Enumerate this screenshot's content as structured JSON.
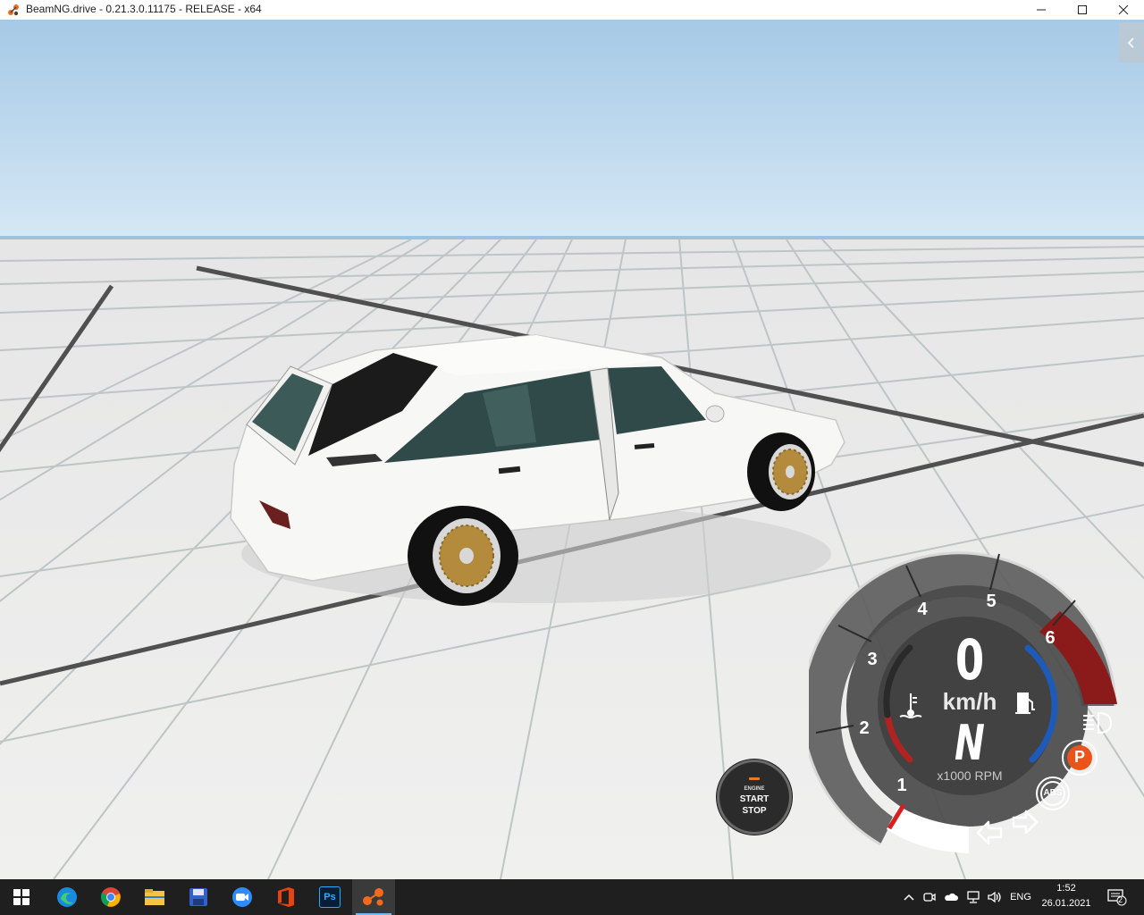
{
  "window": {
    "title": "BeamNG.drive - 0.21.3.0.11175 - RELEASE - x64",
    "controls": [
      "minimize-icon",
      "maximize-icon",
      "close-icon"
    ]
  },
  "scene": {
    "description_icons": [
      "chevron-left-icon"
    ],
    "sky_color": "#c6dff2",
    "ground_color": "#dededd"
  },
  "engine_button": {
    "small_label": "ENGINE",
    "start_label": "START",
    "stop_label": "STOP",
    "led_color": "#f07a18"
  },
  "dashboard": {
    "speed": "0",
    "speed_unit": "km/h",
    "gear": "N",
    "rpm_label": "x1000 RPM",
    "rpm_ticks": [
      "1",
      "2",
      "3",
      "4",
      "5",
      "6"
    ],
    "indicators": [
      "coolant-temp-icon",
      "fuel-icon",
      "headlight-icon",
      "parking-brake-icon",
      "abs-icon",
      "turn-left-icon",
      "turn-right-icon"
    ],
    "parking_label": "P",
    "abs_label": "ABS",
    "redline_color": "#8b1a1a",
    "fuel_bar_color": "#1e5bb8",
    "temp_bar_color": "#b22222"
  },
  "taskbar": {
    "apps": [
      "windows-start-icon",
      "edge-icon",
      "chrome-icon",
      "file-explorer-icon",
      "save-app-icon",
      "zoom-icon",
      "office-icon",
      "photoshop-icon",
      "beamng-icon"
    ],
    "photoshop_label": "Ps",
    "language": "ENG",
    "time": "1:52",
    "date": "26.01.2021",
    "notification_count": "2"
  }
}
